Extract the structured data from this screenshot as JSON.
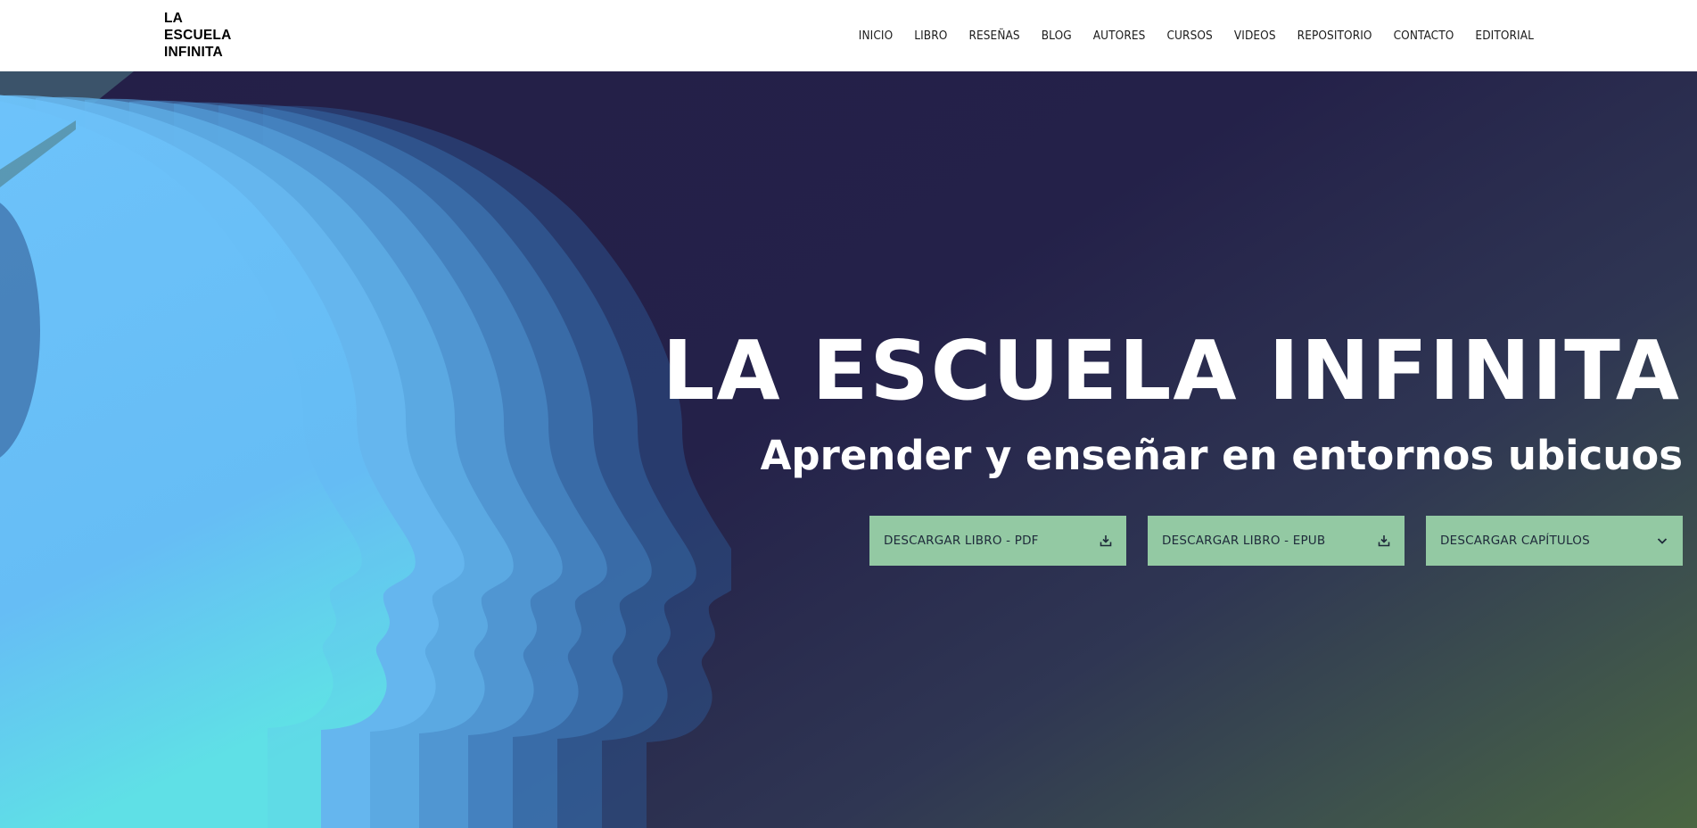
{
  "logo": {
    "lines": [
      "LA",
      "ESCUELA",
      "INFINITA"
    ]
  },
  "nav": {
    "items": [
      "INICIO",
      "LIBRO",
      "RESEÑAS",
      "BLOG",
      "AUTORES",
      "CURSOS",
      "VIDEOS",
      "REPOSITORIO",
      "CONTACTO",
      "EDITORIAL"
    ]
  },
  "hero": {
    "title": "LA ESCUELA INFINITA",
    "subtitle": "Aprender y enseñar en entornos ubicuos",
    "buttons": [
      {
        "label": "DESCARGAR LIBRO - PDF",
        "icon": "download-icon"
      },
      {
        "label": "DESCARGAR LIBRO - EPUB",
        "icon": "download-icon"
      },
      {
        "label": "DESCARGAR CAPÍTULOS",
        "icon": "chevron-down-icon"
      }
    ]
  },
  "colors": {
    "header_bg": "#ffffff",
    "hero_bg_dark": "#241f48",
    "hero_bg_green": "#4a6642",
    "button_bg": "#93c9a3",
    "head_blue": "#6ec3fb"
  }
}
